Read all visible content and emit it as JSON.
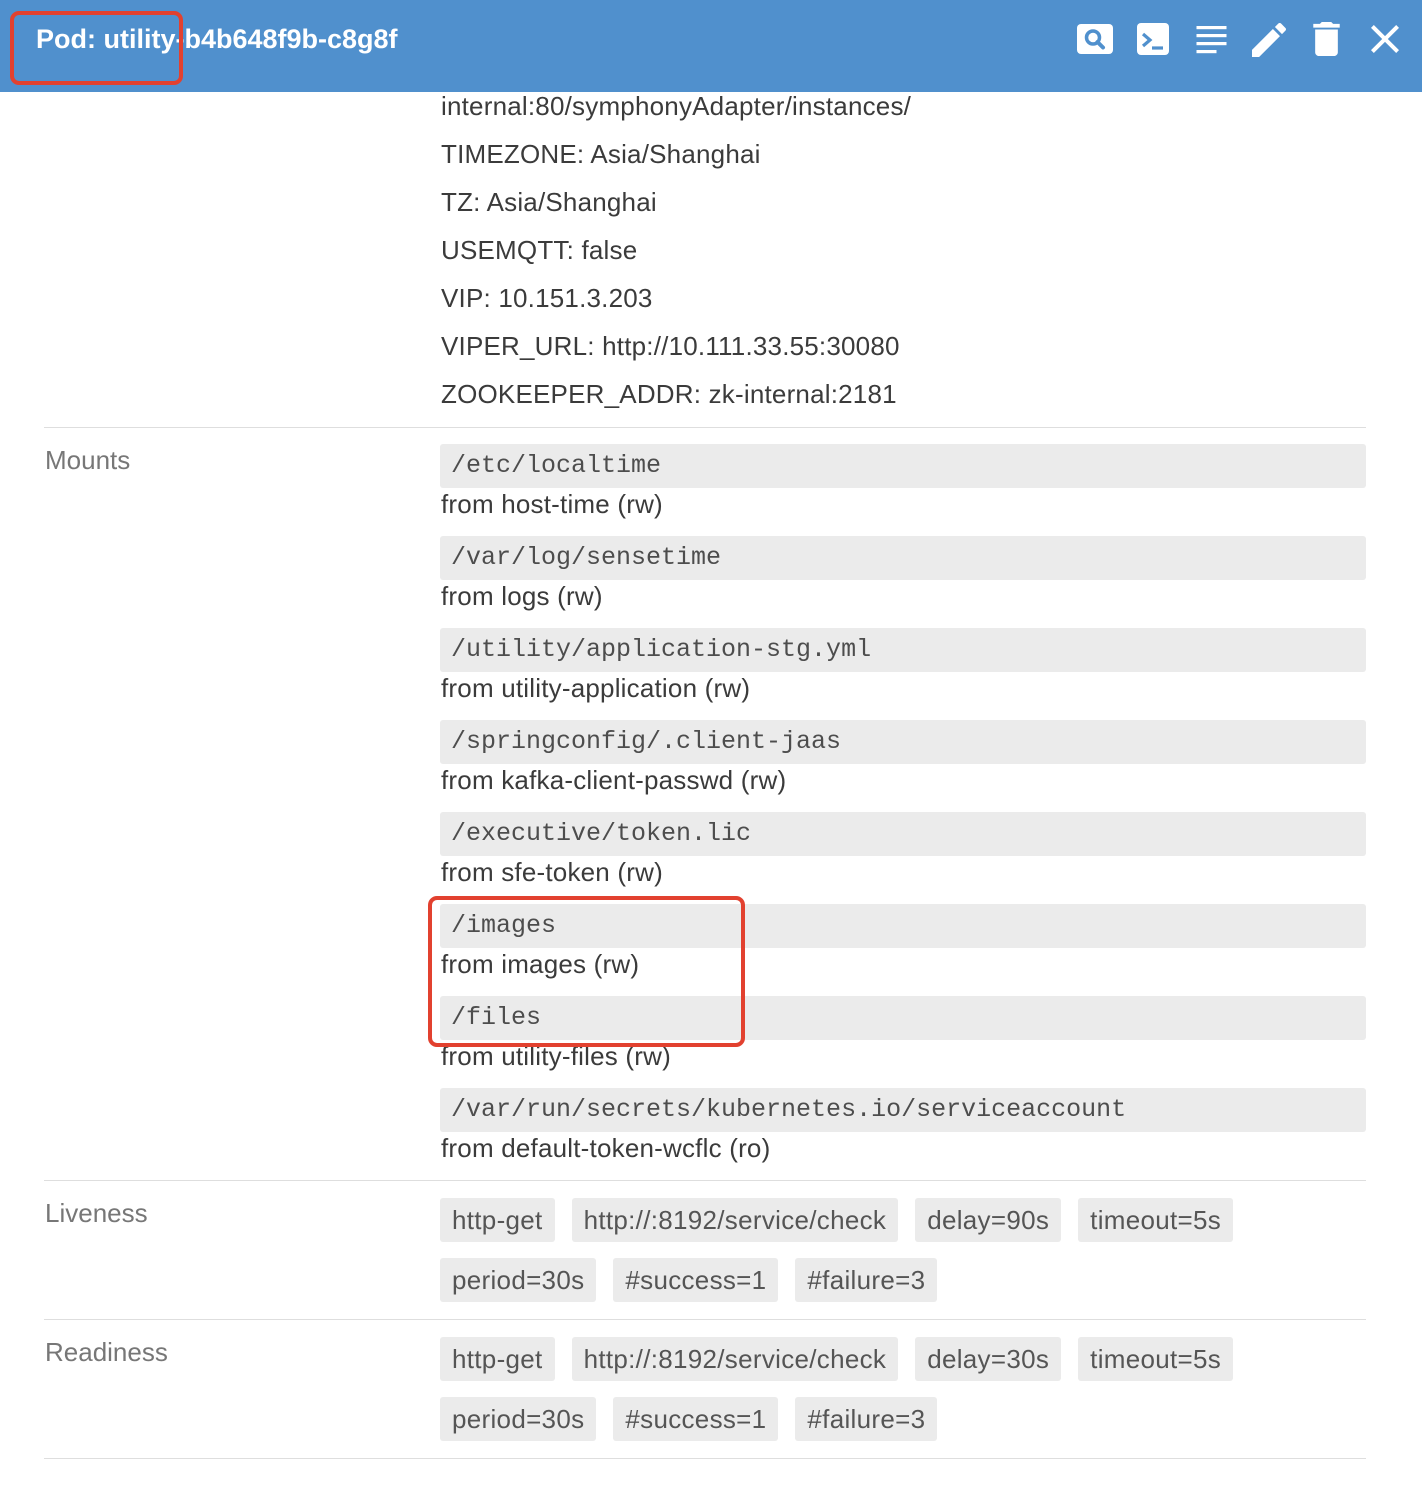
{
  "header": {
    "title": "Pod: utility-b4b648f9b-c8g8f",
    "actions": [
      "search-icon",
      "terminal-icon",
      "logs-icon",
      "edit-icon",
      "delete-icon",
      "close-icon"
    ]
  },
  "environment": {
    "lines": [
      "internal:80/symphonyAdapter/instances/",
      "TIMEZONE: Asia/Shanghai",
      "TZ: Asia/Shanghai",
      "USEMQTT: false",
      "VIP: 10.151.3.203",
      "VIPER_URL: http://10.111.33.55:30080",
      "ZOOKEEPER_ADDR: zk-internal:2181"
    ]
  },
  "mounts": {
    "label": "Mounts",
    "items": [
      {
        "path": "/etc/localtime",
        "source": "from host-time (rw)"
      },
      {
        "path": "/var/log/sensetime",
        "source": "from logs (rw)"
      },
      {
        "path": "/utility/application-stg.yml",
        "source": "from utility-application (rw)"
      },
      {
        "path": "/springconfig/.client-jaas",
        "source": "from kafka-client-passwd (rw)"
      },
      {
        "path": "/executive/token.lic",
        "source": "from sfe-token (rw)"
      },
      {
        "path": "/images",
        "source": "from images (rw)"
      },
      {
        "path": "/files",
        "source": "from utility-files (rw)"
      },
      {
        "path": "/var/run/secrets/kubernetes.io/serviceaccount",
        "source": "from default-token-wcflc (ro)"
      }
    ]
  },
  "liveness": {
    "label": "Liveness",
    "chips": [
      "http-get",
      "http://:8192/service/check",
      "delay=90s",
      "timeout=5s",
      "period=30s",
      "#success=1",
      "#failure=3"
    ]
  },
  "readiness": {
    "label": "Readiness",
    "chips": [
      "http-get",
      "http://:8192/service/check",
      "delay=30s",
      "timeout=5s",
      "period=30s",
      "#success=1",
      "#failure=3"
    ]
  },
  "colors": {
    "header_background": "#5090cd",
    "annotation_red": "#e2412f",
    "code_background": "#ebebeb"
  }
}
